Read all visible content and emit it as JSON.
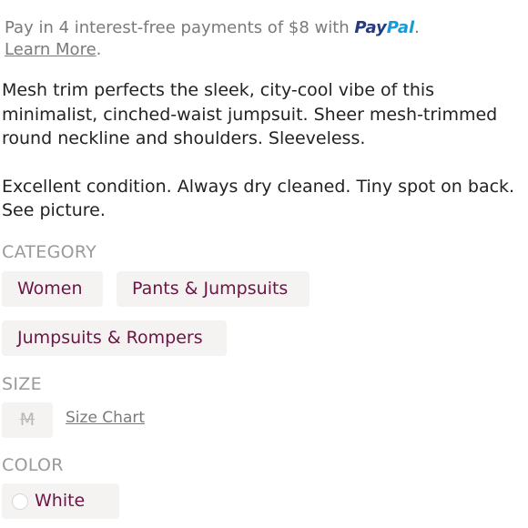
{
  "paypal": {
    "prefix": "Pay in 4 interest-free payments of $8 with ",
    "logo_pay": "Pay",
    "logo_pal": "Pal",
    "suffix": ".",
    "learn_more": "Learn More",
    "learn_more_suffix": "."
  },
  "description": {
    "paragraph1": "Mesh trim perfects the sleek, city-cool vibe of this minimalist, cinched-waist jumpsuit. Sheer mesh-trimmed round neckline and shoulders. Sleeveless.",
    "paragraph2": "Excellent condition. Always dry cleaned. Tiny spot on back. See picture."
  },
  "category": {
    "label": "CATEGORY",
    "items": [
      "Women",
      "Pants & Jumpsuits",
      "Jumpsuits & Rompers"
    ]
  },
  "size": {
    "label": "SIZE",
    "value": "M",
    "size_chart": "Size Chart"
  },
  "color": {
    "label": "COLOR",
    "value": "White",
    "swatch_color": "#ffffff"
  },
  "colors": {
    "accent_text": "#6b1547",
    "chip_bg": "#f5f3f1",
    "paypal_pay": "#253b80",
    "paypal_pal": "#179bd7"
  }
}
